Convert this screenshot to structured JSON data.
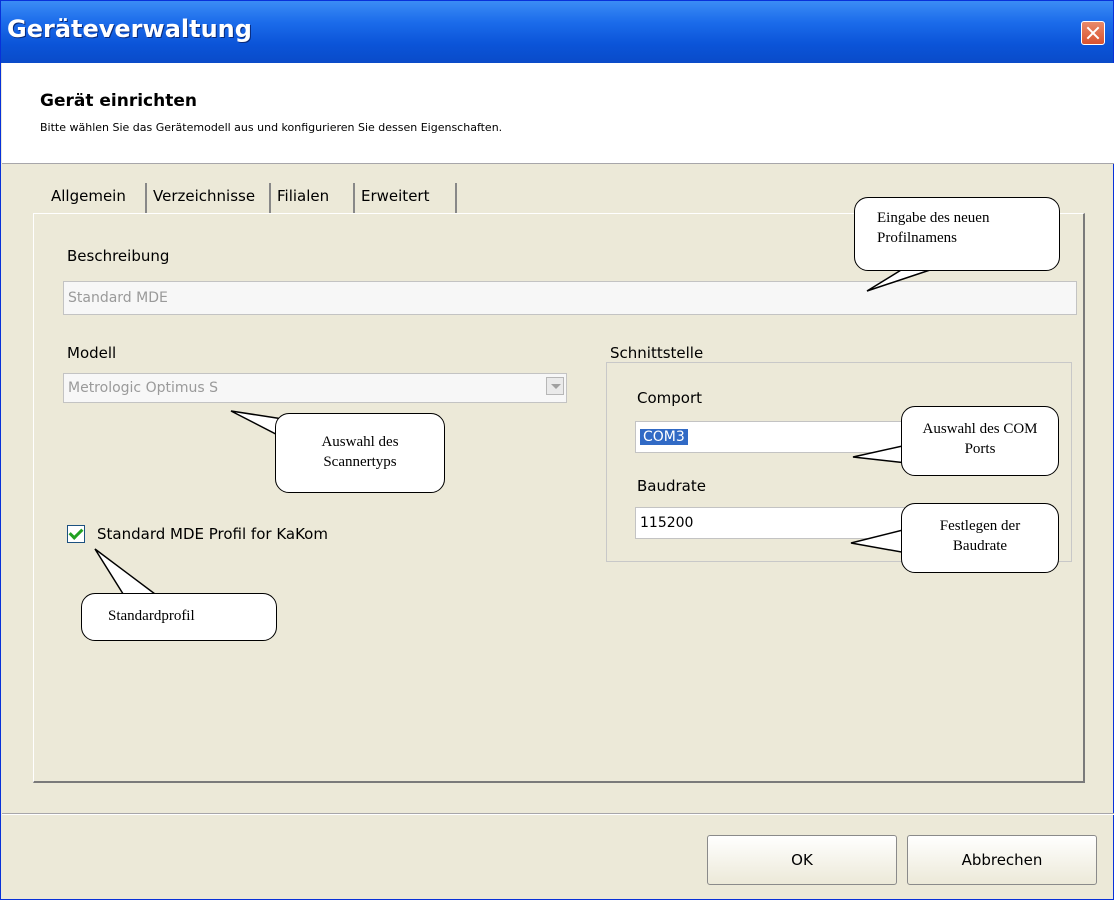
{
  "window": {
    "title": "Geräteverwaltung"
  },
  "header": {
    "title": "Gerät einrichten",
    "subtitle": "Bitte wählen Sie das Gerätemodell aus und konfigurieren Sie dessen Eigenschaften."
  },
  "tabs": [
    {
      "label": "Allgemein"
    },
    {
      "label": "Verzeichnisse"
    },
    {
      "label": "Filialen"
    },
    {
      "label": "Erweitert"
    }
  ],
  "form": {
    "beschreibung_label": "Beschreibung",
    "beschreibung_value": "Standard MDE",
    "modell_label": "Modell",
    "modell_value": "Metrologic Optimus S",
    "interface_group_label": "Schnittstelle",
    "comport_label": "Comport",
    "comport_value": "COM3",
    "baudrate_label": "Baudrate",
    "baudrate_value": "115200",
    "checkbox_label": "Standard MDE Profil for KaKom",
    "checkbox_checked": true
  },
  "buttons": {
    "ok": "OK",
    "cancel": "Abbrechen"
  },
  "callouts": {
    "profile_name": "Eingabe des neuen Profilnamens",
    "scanner_type": "Auswahl des Scannertyps",
    "com_port": "Auswahl des COM Ports",
    "baud_rate": "Festlegen der Baudrate",
    "standard_profile": "Standardprofil"
  },
  "colors": {
    "titlebar": "#0a54d8",
    "selection": "#316ac5",
    "dialog_bg": "#ece9d8"
  },
  "icons": {
    "close": "close-icon",
    "dropdown": "chevron-down-icon",
    "checkbox": "checkmark-icon"
  }
}
